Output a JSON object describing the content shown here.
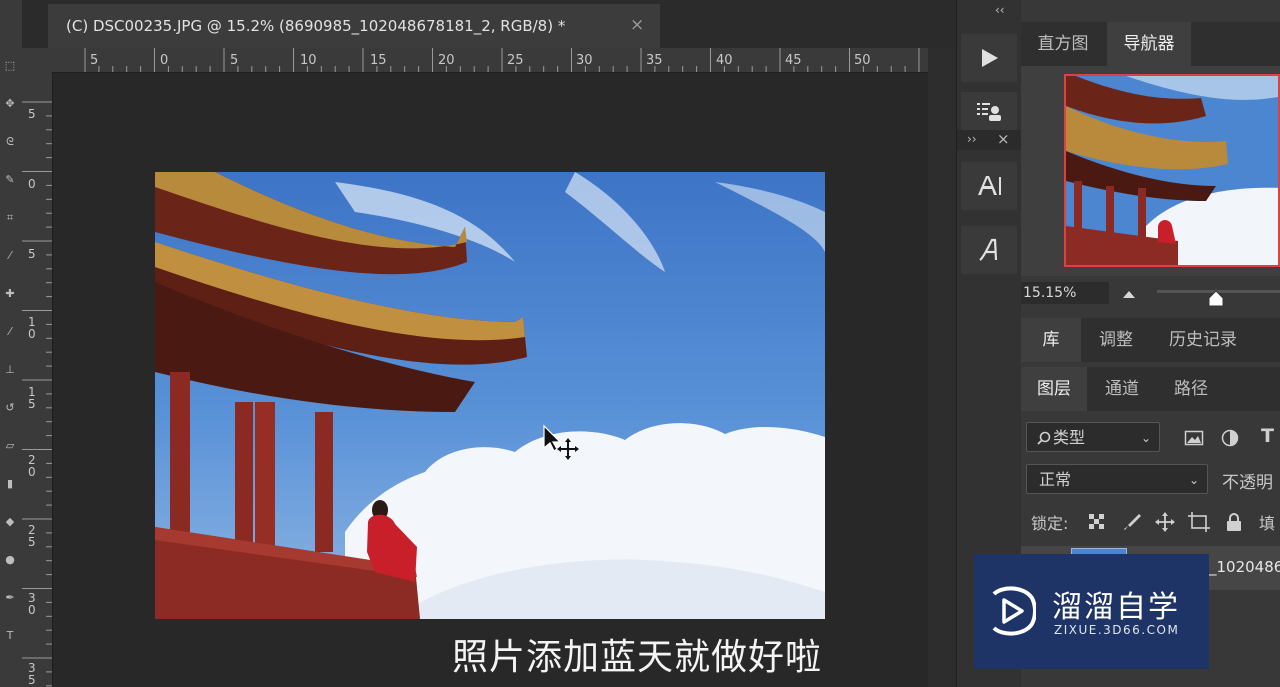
{
  "document": {
    "tab_title": "(C) DSC00235.JPG @ 15.2% (8690985_102048678181_2, RGB/8) *",
    "close_glyph": "×"
  },
  "rulers": {
    "horizontal_labels": [
      "5",
      "0",
      "5",
      "10",
      "15",
      "20",
      "25",
      "30",
      "35",
      "40",
      "45",
      "50"
    ],
    "vertical_labels": [
      "5",
      "0",
      "5",
      "10",
      "15",
      "20",
      "25",
      "30",
      "35"
    ]
  },
  "canvas": {
    "subtitle": "照片添加蓝天就做好啦",
    "cursor_icon": "move-cursor-icon"
  },
  "midcol": {
    "collapse_glyph": "‹‹",
    "collapse_glyph_2": "››",
    "close_glyph": "×"
  },
  "navigator": {
    "tabs": [
      "直方图",
      "导航器"
    ],
    "active_tab": "导航器",
    "zoom_value": "15.15%",
    "zoom_slider_fraction": 0.48
  },
  "panels_middle": {
    "tabs": [
      "库",
      "调整",
      "历史记录"
    ]
  },
  "layers": {
    "tabs": [
      "图层",
      "通道",
      "路径"
    ],
    "filter_label": "类型",
    "blend_mode": "正常",
    "opacity_label": "不透明",
    "lock_label": "锁定:",
    "fill_label": "填",
    "layer_name": "_1020486"
  },
  "watermark": {
    "brand": "溜溜自学",
    "url": "ZIXUE.3D66.COM"
  },
  "colors": {
    "accent_border": "#e04040",
    "watermark_bg": "#1e3466"
  }
}
